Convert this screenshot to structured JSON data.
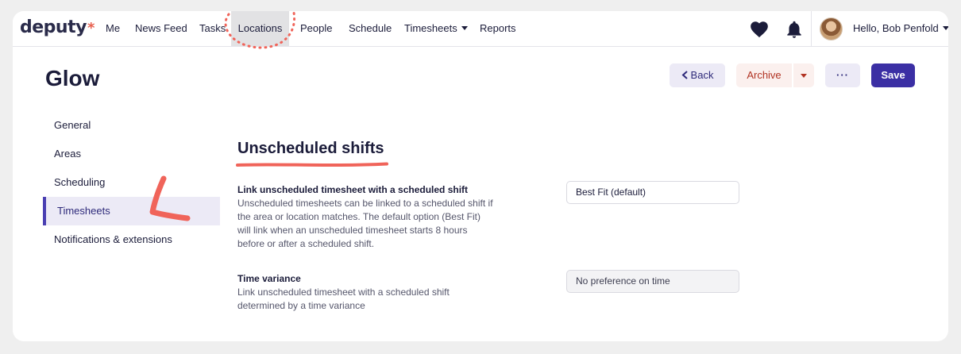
{
  "brand": {
    "logo_text": "deputy",
    "logo_mark": "*",
    "accent": "#e7604f"
  },
  "nav": {
    "items": [
      {
        "label": "Me"
      },
      {
        "label": "News Feed"
      },
      {
        "label": "Tasks"
      },
      {
        "label": "Locations",
        "active": true
      },
      {
        "label": "People"
      },
      {
        "label": "Schedule"
      },
      {
        "label": "Timesheets",
        "has_caret": true
      },
      {
        "label": "Reports"
      }
    ],
    "icons": [
      "heart-icon",
      "bell-icon"
    ],
    "user_greeting": "Hello, Bob Penfold"
  },
  "page": {
    "title": "Glow",
    "actions": {
      "back_label": "Back",
      "archive_label": "Archive",
      "more_label": "···",
      "save_label": "Save"
    }
  },
  "sidebar": {
    "items": [
      {
        "label": "General"
      },
      {
        "label": "Areas"
      },
      {
        "label": "Scheduling"
      },
      {
        "label": "Timesheets",
        "active": true
      },
      {
        "label": "Notifications & extensions"
      }
    ]
  },
  "section": {
    "title": "Unscheduled shifts",
    "settings": [
      {
        "title": "Link unscheduled timesheet with a scheduled shift",
        "description_lines": [
          "Unscheduled timesheets can be linked to a scheduled shift if",
          "the area or location matches. The default option (Best Fit)",
          "will link when an unscheduled timesheet starts 8 hours",
          "before or after a scheduled shift."
        ],
        "value": "Best Fit (default)"
      },
      {
        "title": "Time variance",
        "description_lines": [
          "Link unscheduled timesheet with a scheduled shift",
          "determined by a time variance"
        ],
        "value": "No preference on time"
      }
    ]
  },
  "colors": {
    "primary": "#3b2fa4",
    "annotation": "#f0645a",
    "archive_text": "#b13323"
  }
}
